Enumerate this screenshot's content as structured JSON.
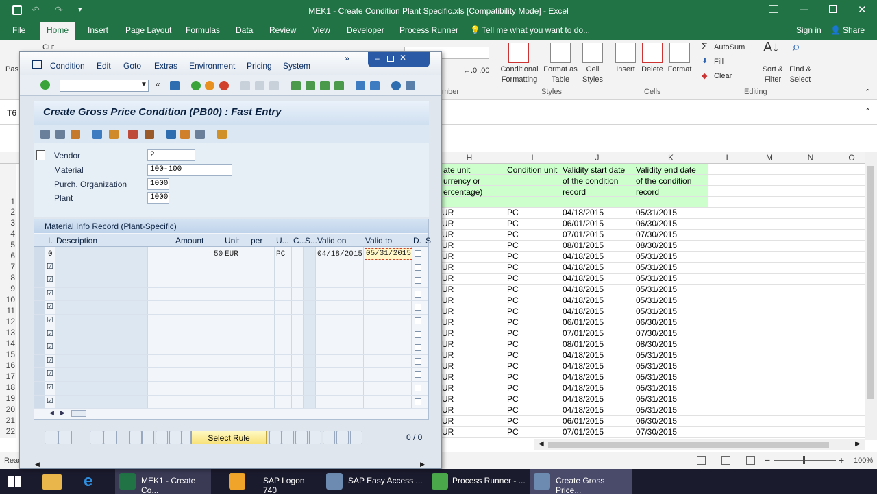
{
  "excel": {
    "title": "MEK1 - Create Condition Plant Specific.xls  [Compatibility Mode] - Excel",
    "tabs": [
      {
        "label": "File"
      },
      {
        "label": "Home"
      },
      {
        "label": "Insert"
      },
      {
        "label": "Page Layout"
      },
      {
        "label": "Formulas"
      },
      {
        "label": "Data"
      },
      {
        "label": "Review"
      },
      {
        "label": "View"
      },
      {
        "label": "Developer"
      },
      {
        "label": "Process Runner"
      }
    ],
    "tell_me": "Tell me what you want to do...",
    "sign_in": "Sign in",
    "share": "Share",
    "ribbon": {
      "conditional_formatting": "Conditional Formatting",
      "format_as_table": "Format as Table",
      "cell_styles": "Cell Styles",
      "insert": "Insert",
      "delete": "Delete",
      "format": "Format",
      "autosum": "AutoSum",
      "fill": "Fill",
      "clear": "Clear",
      "sort_filter": "Sort & Filter",
      "find_select": "Find & Select",
      "group_number": "mber",
      "group_styles": "Styles",
      "group_cells": "Cells",
      "group_editing": "Editing",
      "cut": "Cut",
      "paste": "Pas"
    },
    "name_box": "T6",
    "columns": [
      {
        "label": "H"
      },
      {
        "label": "I"
      },
      {
        "label": "J"
      },
      {
        "label": "K"
      },
      {
        "label": "L"
      },
      {
        "label": "M"
      },
      {
        "label": "N"
      },
      {
        "label": "O"
      }
    ],
    "header_cells": {
      "h": "ate unit\nurrency or\nercentage)",
      "i": "Condition unit",
      "j": "Validity start date\nof the condition\nrecord",
      "k": "Validity end date\nof the condition\nrecord"
    },
    "row_numbers": [
      "1",
      "2",
      "3",
      "4",
      "5",
      "6",
      "7",
      "8",
      "9",
      "10",
      "11",
      "12",
      "13",
      "14",
      "15",
      "16",
      "17",
      "18",
      "19",
      "20",
      "21",
      "22"
    ],
    "rows": [
      {
        "h": "UR",
        "i": "PC",
        "j": "04/18/2015",
        "k": "05/31/2015"
      },
      {
        "h": "UR",
        "i": "PC",
        "j": "06/01/2015",
        "k": "06/30/2015"
      },
      {
        "h": "UR",
        "i": "PC",
        "j": "07/01/2015",
        "k": "07/30/2015"
      },
      {
        "h": "UR",
        "i": "PC",
        "j": "08/01/2015",
        "k": "08/30/2015"
      },
      {
        "h": "UR",
        "i": "PC",
        "j": "04/18/2015",
        "k": "05/31/2015"
      },
      {
        "h": "UR",
        "i": "PC",
        "j": "04/18/2015",
        "k": "05/31/2015"
      },
      {
        "h": "UR",
        "i": "PC",
        "j": "04/18/2015",
        "k": "05/31/2015"
      },
      {
        "h": "UR",
        "i": "PC",
        "j": "04/18/2015",
        "k": "05/31/2015"
      },
      {
        "h": "UR",
        "i": "PC",
        "j": "04/18/2015",
        "k": "05/31/2015"
      },
      {
        "h": "UR",
        "i": "PC",
        "j": "04/18/2015",
        "k": "05/31/2015"
      },
      {
        "h": "UR",
        "i": "PC",
        "j": "06/01/2015",
        "k": "06/30/2015"
      },
      {
        "h": "UR",
        "i": "PC",
        "j": "07/01/2015",
        "k": "07/30/2015"
      },
      {
        "h": "UR",
        "i": "PC",
        "j": "08/01/2015",
        "k": "08/30/2015"
      },
      {
        "h": "UR",
        "i": "PC",
        "j": "04/18/2015",
        "k": "05/31/2015"
      },
      {
        "h": "UR",
        "i": "PC",
        "j": "04/18/2015",
        "k": "05/31/2015"
      },
      {
        "h": "UR",
        "i": "PC",
        "j": "04/18/2015",
        "k": "05/31/2015"
      },
      {
        "h": "UR",
        "i": "PC",
        "j": "04/18/2015",
        "k": "05/31/2015"
      },
      {
        "h": "UR",
        "i": "PC",
        "j": "04/18/2015",
        "k": "05/31/2015"
      },
      {
        "h": "UR",
        "i": "PC",
        "j": "04/18/2015",
        "k": "05/31/2015"
      },
      {
        "h": "UR",
        "i": "PC",
        "j": "06/01/2015",
        "k": "06/30/2015"
      },
      {
        "h": "UR",
        "i": "PC",
        "j": "07/01/2015",
        "k": "07/30/2015"
      }
    ],
    "status_left": "Read",
    "zoom": "100%"
  },
  "sap": {
    "menu": [
      {
        "label": "Condition"
      },
      {
        "label": "Edit"
      },
      {
        "label": "Goto"
      },
      {
        "label": "Extras"
      },
      {
        "label": "Environment"
      },
      {
        "label": "Pricing"
      },
      {
        "label": "System"
      }
    ],
    "title": "Create Gross Price Condition (PB00) : Fast Entry",
    "fields": [
      {
        "label": "Vendor",
        "value": "2"
      },
      {
        "label": "Material",
        "value": "100-100"
      },
      {
        "label": "Purch. Organization",
        "value": "1000"
      },
      {
        "label": "Plant",
        "value": "1000"
      }
    ],
    "section_title": "Material Info Record (Plant-Specific)",
    "columns": {
      "i": "I.",
      "description": "Description",
      "amount": "Amount",
      "unit": "Unit",
      "per": "per",
      "u": "U...",
      "c": "C...",
      "s": "S...",
      "valid_on": "Valid on",
      "valid_to": "Valid to",
      "d": "D.",
      "s2": "S"
    },
    "first_row": {
      "i": "0",
      "amount": "50",
      "unit": "EUR",
      "uom": "PC",
      "valid_on": "04/18/2015",
      "valid_to": "05/31/2015"
    },
    "select_rule": "Select Rule",
    "page_counter": "0 / 0"
  },
  "taskbar": [
    {
      "label": "MEK1 - Create Co..."
    },
    {
      "label": "SAP Logon 740"
    },
    {
      "label": "SAP Easy Access ..."
    },
    {
      "label": "Process Runner - ..."
    },
    {
      "label": "Create Gross Price..."
    }
  ]
}
